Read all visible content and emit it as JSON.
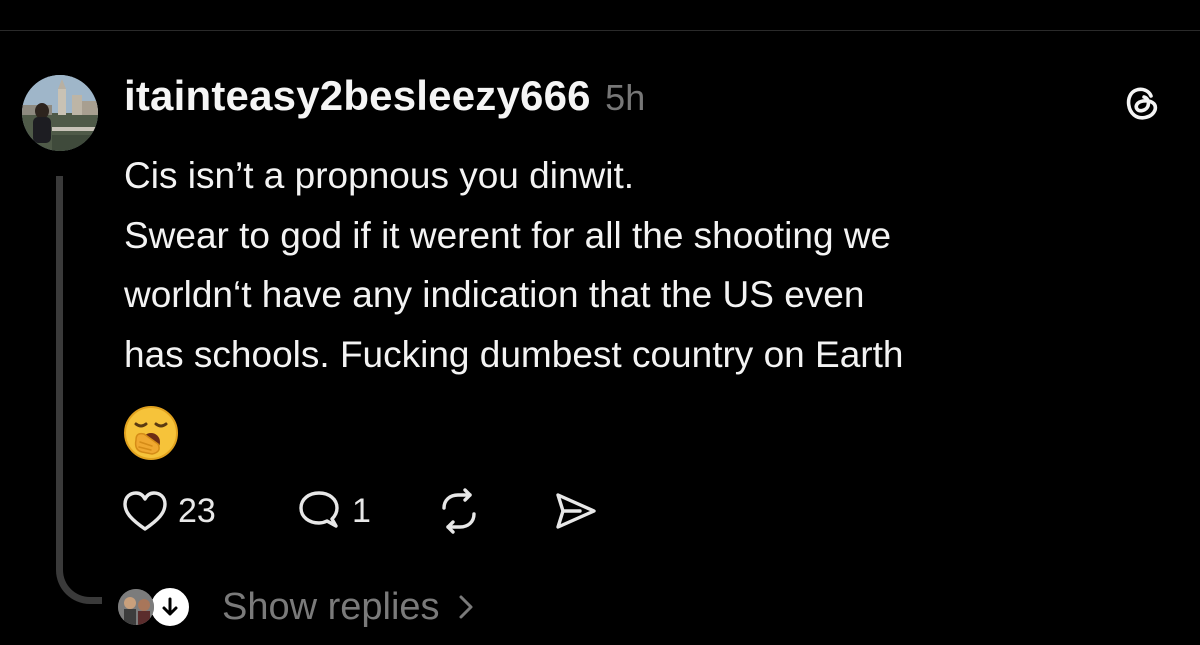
{
  "post": {
    "username": "itainteasy2besleezy666",
    "timestamp": "5h",
    "lines": [
      "Cis isn’t a propnous you dinwit.",
      "Swear to god if it werent for all the shooting we",
      "worldn‘t have any indication that the US even",
      "has schools. Fucking dumbest country on Earth"
    ],
    "emoji": "yawning-face-emoji",
    "app_icon": "threads-logo-icon"
  },
  "actions": {
    "like_count": "23",
    "reply_count": "1",
    "icons": [
      "heart-icon",
      "comment-icon",
      "repost-icon",
      "share-icon"
    ]
  },
  "replies": {
    "label": "Show replies"
  },
  "colors": {
    "background": "#000000",
    "text": "#f3f3f3",
    "muted": "#777777",
    "thread_line": "#3a3a3a"
  }
}
